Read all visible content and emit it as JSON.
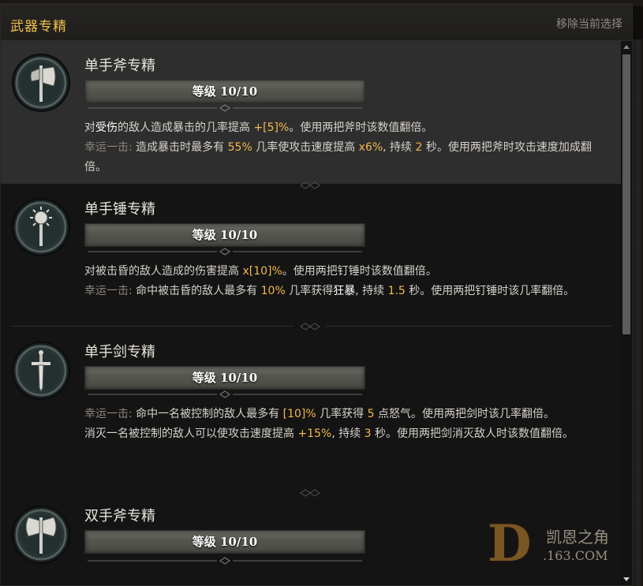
{
  "header": {
    "title": "武器专精",
    "clear_label": "移除当前选择"
  },
  "accent_color": "#f0c04a",
  "highlight_color": "#f2b94d",
  "entries": [
    {
      "name": "单手斧专精",
      "icon": "one-hand-axe-icon",
      "level_label": "等级 10/10",
      "level": 10,
      "level_max": 10,
      "selected": true,
      "lines": [
        [
          "对",
          "受伤",
          "的敌人造成暴击的几率提高 ",
          "+[5]%",
          "。使用两把斧时该数值翻倍。"
        ],
        [
          "幸运一击: ",
          "造成暴击时最多有 ",
          "55%",
          " 几率使攻击速度提高 ",
          "x6%",
          ", 持续 ",
          "2",
          " 秒。使用两把斧时攻击速度加成翻倍。"
        ]
      ]
    },
    {
      "name": "单手锤专精",
      "icon": "one-hand-mace-icon",
      "level_label": "等级 10/10",
      "level": 10,
      "level_max": 10,
      "selected": false,
      "lines": [
        [
          "对被击昏的敌人造成的伤害提高 ",
          "x[10]%",
          "。使用两把钉锤时该数值翻倍。"
        ],
        [
          "幸运一击: ",
          "命中被击昏的敌人最多有 ",
          "10%",
          " 几率获得",
          "狂暴",
          ", 持续 ",
          "1.5",
          " 秒。使用两把钉锤时该几率翻倍。"
        ]
      ]
    },
    {
      "name": "单手剑专精",
      "icon": "one-hand-sword-icon",
      "level_label": "等级 10/10",
      "level": 10,
      "level_max": 10,
      "selected": false,
      "lines": [
        [
          "幸运一击: ",
          "命中一名被控制的敌人最多有 ",
          "[10]%",
          " 几率获得 ",
          "5",
          " 点怒气。使用两把剑时该几率翻倍。"
        ],
        [
          "消灭一名被控制的敌人可以使攻击速度提高 ",
          "+15%",
          ", 持续 ",
          "3",
          " 秒。使用两把剑消灭敌人时该数值翻倍。"
        ]
      ]
    },
    {
      "name": "双手斧专精",
      "icon": "two-hand-axe-icon",
      "level_label": "等级 10/10",
      "level": 10,
      "level_max": 10,
      "selected": false
    }
  ],
  "watermark": {
    "logo_letter": "D",
    "text": "凯恩之角",
    "url": ".163.COM"
  }
}
